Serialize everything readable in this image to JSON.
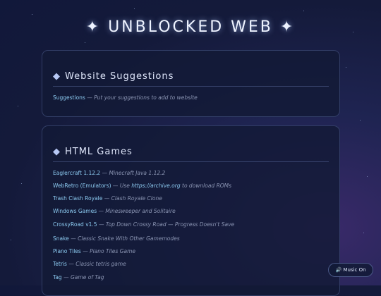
{
  "header": {
    "title": "✦ UNBLOCKED WEB ✦"
  },
  "sections": [
    {
      "heading": "Website Suggestions",
      "items": [
        {
          "link": "Suggestions",
          "desc": "Put your suggestions to add to website"
        }
      ]
    },
    {
      "heading": "HTML Games",
      "items": [
        {
          "link": "Eaglercraft 1.12.2",
          "desc": "Minecraft Java 1.12.2"
        },
        {
          "link": "WebRetro (Emulators)",
          "desc_pre": "Use ",
          "desc_link": "https://archive.org",
          "desc_post": " to download ROMs"
        },
        {
          "link": "Trash Clash Royale",
          "desc": "Clash Royale Clone"
        },
        {
          "link": "Windows Games",
          "desc": "Minesweeper and Solitaire"
        },
        {
          "link": "CrossyRoad v1.5",
          "desc": "Top Down Crossy Road — Progress Doesn't Save"
        },
        {
          "link": "Snake",
          "desc": "Classic Snake With Other Gamemodes"
        },
        {
          "link": "Piano Tiles",
          "desc": "Piano Tiles Game"
        },
        {
          "link": "Tetris",
          "desc": "Classic tetris game"
        },
        {
          "link": "Tag",
          "desc": "Game of Tag"
        }
      ]
    }
  ],
  "separator": "—",
  "diamond_icon": "◆",
  "music_button": {
    "icon": "🔊",
    "label": "Music On"
  }
}
